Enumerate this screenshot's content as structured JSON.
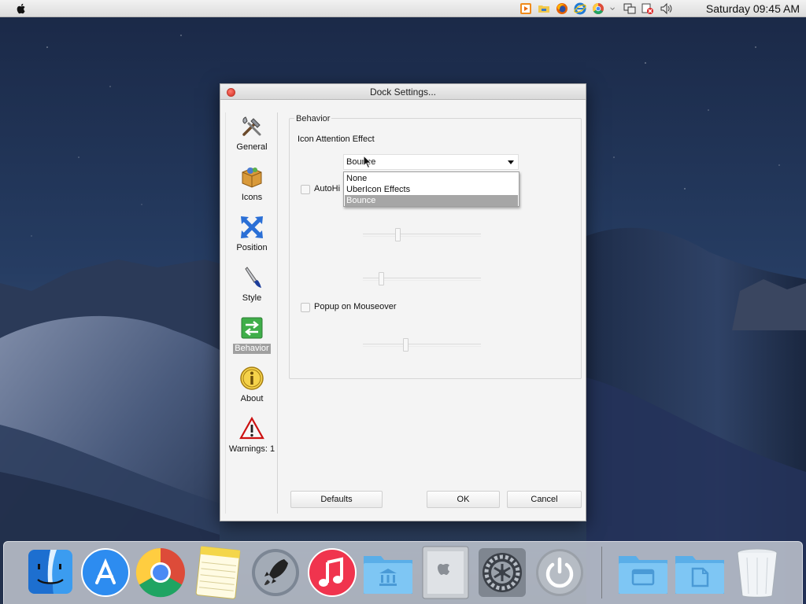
{
  "menubar": {
    "clock": "Saturday 09:45 AM",
    "tray_icons": [
      "media-player-icon",
      "network-folder-icon",
      "firefox-icon",
      "ie-icon",
      "chrome-icon",
      "chevron-down-icon",
      "network-icon",
      "security-alert-icon",
      "volume-icon"
    ]
  },
  "window": {
    "title": "Dock Settings...",
    "sidebar": {
      "items": [
        {
          "label": "General",
          "icon": "tools-icon"
        },
        {
          "label": "Icons",
          "icon": "package-icon"
        },
        {
          "label": "Position",
          "icon": "arrows-icon"
        },
        {
          "label": "Style",
          "icon": "brush-icon"
        },
        {
          "label": "Behavior",
          "icon": "swap-arrows-icon",
          "selected": true
        },
        {
          "label": "About",
          "icon": "info-icon"
        },
        {
          "label": "Warnings: 1",
          "icon": "warning-icon"
        }
      ]
    },
    "behavior": {
      "group_title": "Behavior",
      "icon_attention_label": "Icon Attention Effect",
      "combo_value": "Bounce",
      "dropdown_options": [
        "None",
        "UberIcon Effects",
        "Bounce"
      ],
      "dropdown_selected": "Bounce",
      "autohide_label": "AutoHi",
      "popup_label": "Popup on Mouseover"
    },
    "buttons": {
      "defaults": "Defaults",
      "ok": "OK",
      "cancel": "Cancel"
    }
  },
  "dock": {
    "items": [
      "finder-icon",
      "app-store-icon",
      "chrome-icon",
      "notes-icon",
      "launchpad-icon",
      "music-icon",
      "applications-folder-icon",
      "mac-pro-icon",
      "system-preferences-icon",
      "power-icon",
      "documents-folder-icon",
      "downloads-folder-icon",
      "trash-icon"
    ]
  },
  "colors": {
    "accent_selection": "#a0a0a0",
    "close_button": "#e0443a",
    "menubar": "#e6e6e6",
    "dock_folder": "#6fbcf0"
  }
}
